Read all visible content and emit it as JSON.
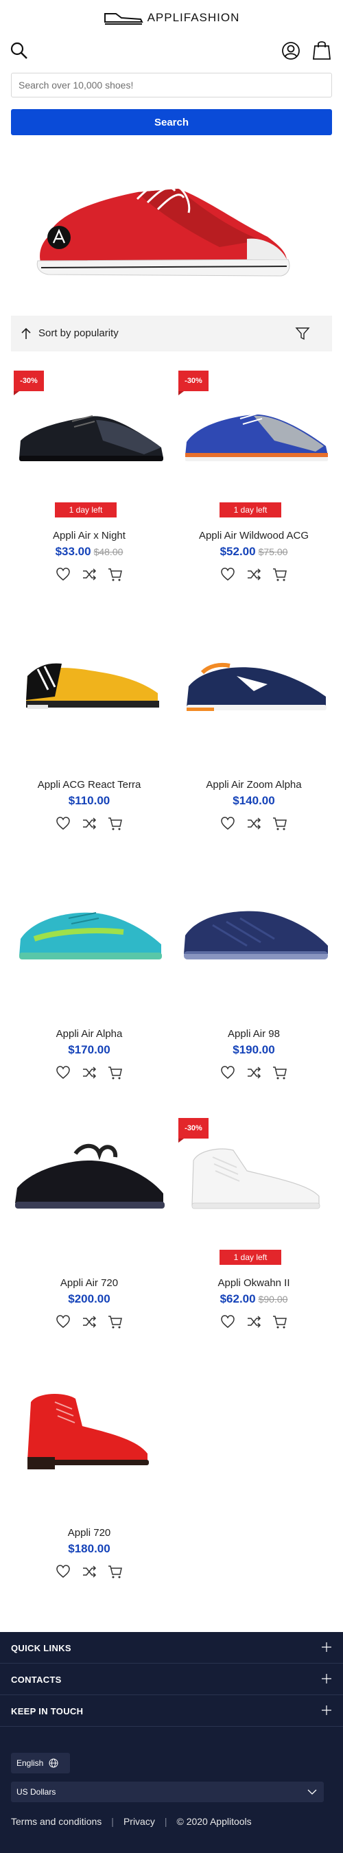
{
  "header": {
    "brand": "APPLIFASHION",
    "search_placeholder": "Search over 10,000 shoes!",
    "search_button": "Search"
  },
  "sort": {
    "label": "Sort by popularity"
  },
  "products": [
    {
      "name": "Appli Air x Night",
      "price": "$33.00",
      "old_price": "$48.00",
      "discount": "-30%",
      "badge": "1 day left"
    },
    {
      "name": "Appli Air Wildwood ACG",
      "price": "$52.00",
      "old_price": "$75.00",
      "discount": "-30%",
      "badge": "1 day left"
    },
    {
      "name": "Appli ACG React Terra",
      "price": "$110.00"
    },
    {
      "name": "Appli Air Zoom Alpha",
      "price": "$140.00"
    },
    {
      "name": "Appli Air Alpha",
      "price": "$170.00"
    },
    {
      "name": "Appli Air 98",
      "price": "$190.00"
    },
    {
      "name": "Appli Air 720",
      "price": "$200.00"
    },
    {
      "name": "Appli Okwahn II",
      "price": "$62.00",
      "old_price": "$90.00",
      "discount": "-30%",
      "badge": "1 day left"
    },
    {
      "name": "Appli 720",
      "price": "$180.00"
    }
  ],
  "footer": {
    "sections": [
      "QUICK LINKS",
      "CONTACTS",
      "KEEP IN TOUCH"
    ],
    "language": "English",
    "currency": "US Dollars",
    "links": [
      "Terms and conditions",
      "Privacy",
      "© 2020 Applitools"
    ]
  },
  "colors": {
    "accent": "#0a4bd8",
    "discount": "#e3262b",
    "price": "#1543b9",
    "footer_bg": "#151d36"
  }
}
